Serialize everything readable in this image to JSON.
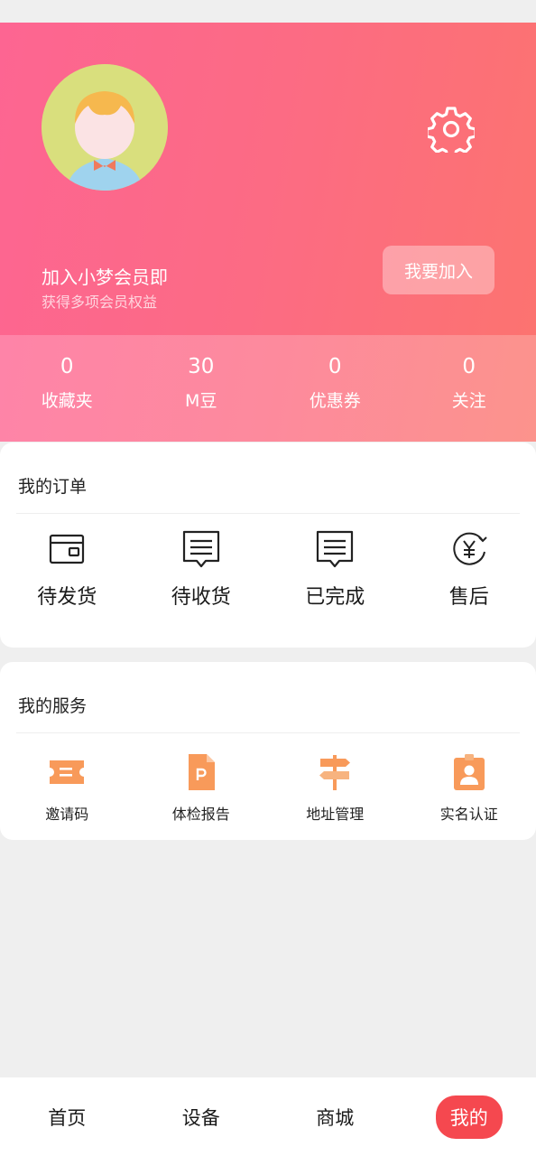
{
  "header": {
    "membership_title": "加入小梦会员即",
    "membership_subtitle": "获得多项会员权益",
    "join_button": "我要加入"
  },
  "stats": [
    {
      "value": "0",
      "label": "收藏夹"
    },
    {
      "value": "30",
      "label": "M豆"
    },
    {
      "value": "0",
      "label": "优惠券"
    },
    {
      "value": "0",
      "label": "关注"
    }
  ],
  "orders": {
    "title": "我的订单",
    "items": [
      {
        "label": "待发货",
        "icon": "wallet-icon"
      },
      {
        "label": "待收货",
        "icon": "message-list-icon"
      },
      {
        "label": "已完成",
        "icon": "message-list-icon"
      },
      {
        "label": "售后",
        "icon": "yen-refund-icon"
      }
    ]
  },
  "services": {
    "title": "我的服务",
    "items": [
      {
        "label": "邀请码",
        "icon": "ticket-icon"
      },
      {
        "label": "体检报告",
        "icon": "pdf-document-icon"
      },
      {
        "label": "地址管理",
        "icon": "signpost-icon"
      },
      {
        "label": "实名认证",
        "icon": "id-badge-icon"
      }
    ]
  },
  "tabbar": {
    "items": [
      {
        "label": "首页"
      },
      {
        "label": "设备"
      },
      {
        "label": "商城"
      },
      {
        "label": "我的"
      }
    ],
    "active_index": 3
  },
  "colors": {
    "header_start": "#fd6592",
    "header_end": "#fc7370",
    "service_icon": "#f89a5a",
    "active_tab": "#f5484f",
    "page_bg": "#efefef"
  }
}
